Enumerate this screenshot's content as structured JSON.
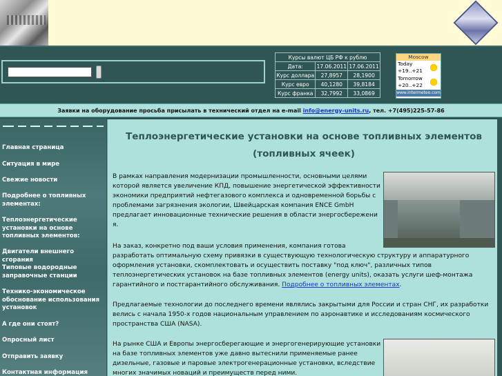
{
  "rates": {
    "title": "Курсы валют ЦБ РФ к рублю",
    "date_label": "Дата:",
    "date1": "17.06.2011",
    "date2": "17.06.2011",
    "rows": [
      {
        "label": "Курс доллара",
        "v1": "27,8957",
        "v2": "28,1900"
      },
      {
        "label": "Курс евро",
        "v1": "40,1280",
        "v2": "39,8184"
      },
      {
        "label": "Курс франка",
        "v1": "32,7992",
        "v2": "33,0869"
      }
    ]
  },
  "weather": {
    "city": "Moscow",
    "today_label": "Today",
    "today_temp": "+19..+21",
    "tomorrow_label": "Tomorrow",
    "tomorrow_temp": "+20..+22",
    "site": "www.intermeteo.com"
  },
  "notice": {
    "text_before": "Заявки на оборудование просьба присылать в технический отдел на e-mail ",
    "email": "info@energy-units.ru",
    "text_after": ", тел. +7(495)225-57-86"
  },
  "sidebar": {
    "items": [
      "Главная страница",
      "Ситуация в мире",
      "Свежие новости",
      "Подробнее о топливных элементах:",
      "Теплоэнергетические установки на основе топливных элементов:",
      "Двигатели внешнего сгорания",
      "Типовые водородные заправочные станции",
      "Технико-экономическое обоснование использования установок",
      "А где они стоят?",
      "Опросный лист",
      "Отправить заявку",
      "Контактная информация"
    ]
  },
  "main": {
    "title_line1": "Теплоэнергетические установки на основе топливных элементов",
    "title_line2": "(топливных ячеек)",
    "p1": [
      "В рамках направления модернизации промышленности, основными целями",
      "которой является увеличение КПД, повышение энергетической эффективности",
      "экономики предприятий нефтегазового комплекса и одновременной борьбы с",
      "проблемами загрязнения экологии, Швейцарская компания ENCE GmbH",
      "предлагает инновационные технические решения в области энергосбережени",
      "я."
    ],
    "p2": [
      "На заказ, конкретно под ваши условия применения, компания готова",
      "разработать оптимальную схему привязки в существующую технологическую структуру и аппаратурного",
      "оформления установки, скомплектовать и осуществить поставку \"под ключ\", различных типов",
      "теплоэнергетических установок на базе топливных элементов (energy units), оказать услуги шеф-монтажа",
      "гарантийного и постгарантийного обслуживания."
    ],
    "p2_link": "Подробнее о топливных элементах",
    "p2_end": ".",
    "p3": [
      "Предлагаемые технологии до последнего времени являлись закрытыми для России и стран СНГ, их разработки",
      "велись с начала 1950-х годов национальным управлением по аэронавтике и исследованиям космического",
      "пространства США (NASA)."
    ],
    "p4": [
      "На рынке США и Европы энергосберегающие и энергогенерирующие установки",
      "на базе топливных элементов уже давно вытеснили применяемые ранее",
      "дизельные, газовые и паровые электрогенерационные установки, вследствие",
      "многих значимых новаций и преимуществ перед ними."
    ]
  }
}
